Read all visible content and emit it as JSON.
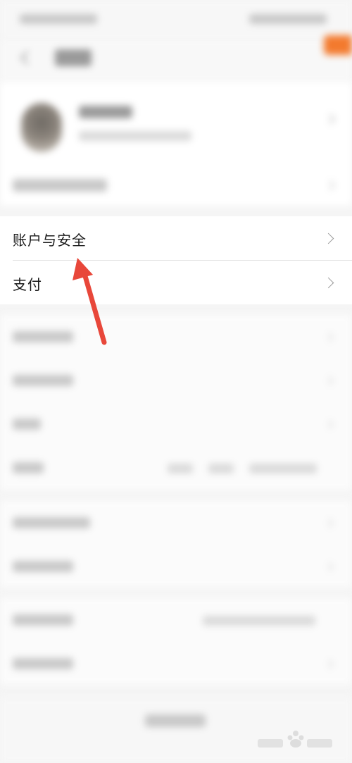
{
  "settings": {
    "rows": [
      {
        "label": "账户与安全"
      },
      {
        "label": "支付"
      }
    ]
  },
  "colors": {
    "accent_orange": "#f37a2e",
    "annotation_red": "#e8473a"
  },
  "icons": {
    "back": "chevron-left-icon",
    "row_arrow": "chevron-right-icon",
    "annotation": "red-arrow"
  }
}
